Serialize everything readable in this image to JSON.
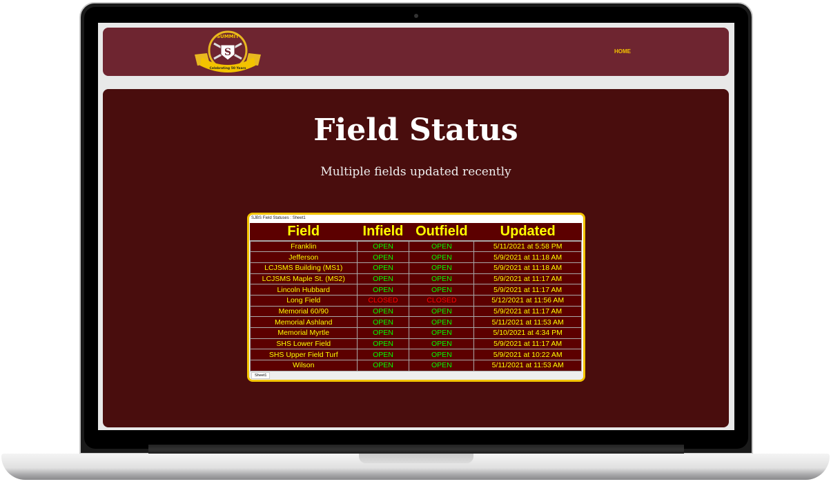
{
  "header": {
    "logo_text": [
      "SUMMIT",
      "JUNIOR",
      "S",
      "BASEBALL & SOFTBALL",
      "1971",
      "2021",
      "Celebrating 50 Years"
    ],
    "nav": {
      "home": "HOME"
    }
  },
  "page": {
    "title": "Field Status",
    "subtitle": "Multiple fields updated recently"
  },
  "sheet": {
    "title": "SJBS Field Statuses : Sheet1",
    "tab": "Sheet1",
    "columns": [
      "Field",
      "Infield",
      "Outfield",
      "Updated"
    ],
    "rows": [
      [
        "Franklin",
        "OPEN",
        "OPEN",
        "5/11/2021 at 5:58 PM"
      ],
      [
        "Jefferson",
        "OPEN",
        "OPEN",
        "5/9/2021 at 11:18 AM"
      ],
      [
        "LCJSMS Building (MS1)",
        "OPEN",
        "OPEN",
        "5/9/2021 at 11:18 AM"
      ],
      [
        "LCJSMS Maple St. (MS2)",
        "OPEN",
        "OPEN",
        "5/9/2021 at 11:17 AM"
      ],
      [
        "Lincoln Hubbard",
        "OPEN",
        "OPEN",
        "5/9/2021 at 11:17 AM"
      ],
      [
        "Long Field",
        "CLOSED",
        "CLOSED",
        "5/12/2021 at 11:56 AM"
      ],
      [
        "Memorial 60/90",
        "OPEN",
        "OPEN",
        "5/9/2021 at 11:17 AM"
      ],
      [
        "Memorial Ashland",
        "OPEN",
        "OPEN",
        "5/11/2021 at 11:53 AM"
      ],
      [
        "Memorial Myrtle",
        "OPEN",
        "OPEN",
        "5/10/2021 at 4:34 PM"
      ],
      [
        "SHS Lower Field",
        "OPEN",
        "OPEN",
        "5/9/2021 at 11:17 AM"
      ],
      [
        "SHS Upper Field Turf",
        "OPEN",
        "OPEN",
        "5/9/2021 at 10:22 AM"
      ],
      [
        "Wilson",
        "OPEN",
        "OPEN",
        "5/11/2021 at 11:53 AM"
      ]
    ]
  },
  "colors": {
    "header": "#6e2530",
    "main": "#490d0d",
    "accent": "#f3c300",
    "open": "#00ff00",
    "closed": "#ff0000"
  }
}
